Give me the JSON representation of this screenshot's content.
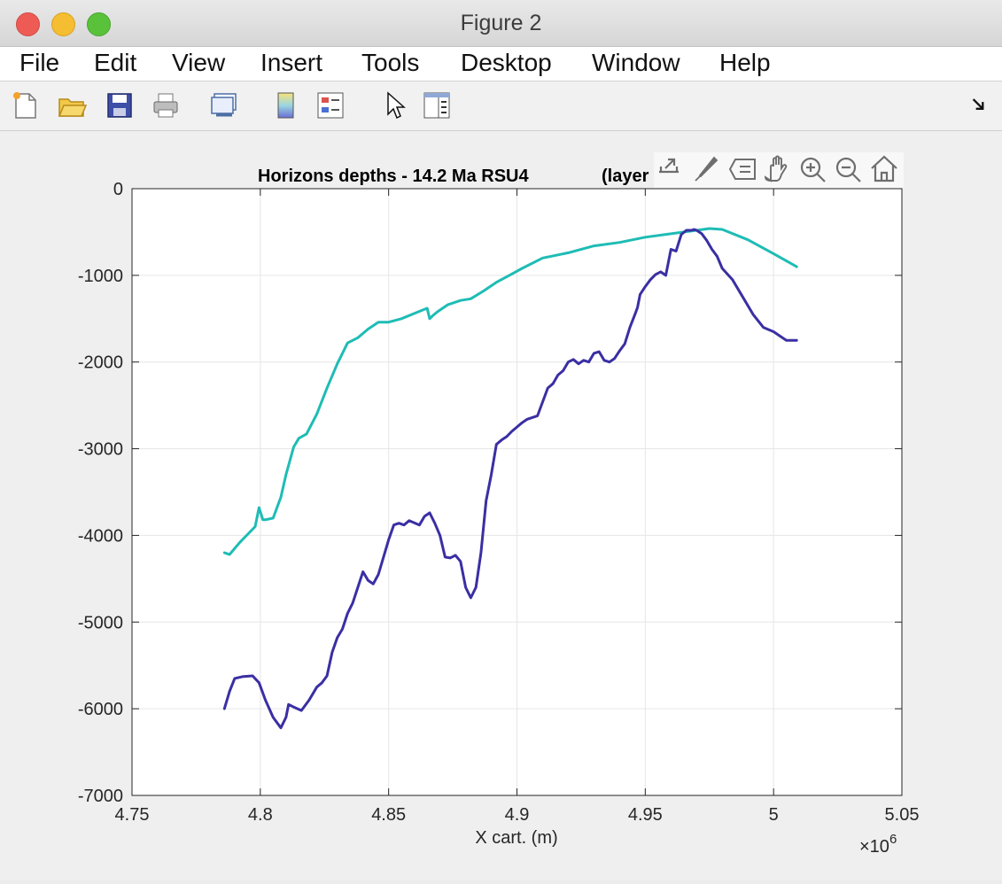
{
  "window": {
    "title": "Figure 2"
  },
  "menu": [
    "File",
    "Edit",
    "View",
    "Insert",
    "Tools",
    "Desktop",
    "Window",
    "Help"
  ],
  "toolbar_icons": [
    "new-figure-icon",
    "open-file-icon",
    "save-icon",
    "print-icon",
    "link-plot-icon",
    "colorbar-icon",
    "legend-icon",
    "edit-pointer-icon",
    "property-inspector-icon",
    "dock-arrow-icon"
  ],
  "axes_toolbar_icons": [
    "export-icon",
    "brush-icon",
    "datatips-icon",
    "pan-icon",
    "zoom-in-icon",
    "zoom-out-icon",
    "home-icon"
  ],
  "colors": {
    "cyan_series": "#1ebcb5",
    "blue_series": "#3a2fa3"
  },
  "chart_data": {
    "type": "line",
    "title_left": "Horizons depths - 14.2 Ma   RSU4",
    "title_right": "(layer",
    "xlabel": "X cart. (m)",
    "x_multiplier": "×10",
    "x_multiplier_exp": "6",
    "ylabel": "",
    "xlim": [
      4750000,
      5050000
    ],
    "ylim": [
      -7000,
      0
    ],
    "xticks": [
      4750000,
      4800000,
      4850000,
      4900000,
      4950000,
      5000000,
      5050000
    ],
    "xtick_labels": [
      "4.75",
      "4.8",
      "4.85",
      "4.9",
      "4.95",
      "5",
      "5.05"
    ],
    "yticks": [
      0,
      -1000,
      -2000,
      -3000,
      -4000,
      -5000,
      -6000,
      -7000
    ],
    "ytick_labels": [
      "0",
      "-1000",
      "-2000",
      "-3000",
      "-4000",
      "-5000",
      "-6000",
      "-7000"
    ],
    "grid": true,
    "series": [
      {
        "color": "#1ebcb5",
        "x": [
          4786000,
          4788000,
          4792000,
          4796000,
          4798000,
          4799500,
          4801000,
          4802000,
          4805000,
          4808000,
          4810000,
          4813000,
          4815000,
          4818000,
          4822000,
          4826000,
          4830000,
          4834000,
          4838000,
          4842000,
          4846000,
          4850000,
          4855000,
          4860000,
          4865000,
          4866000,
          4867000,
          4869000,
          4873000,
          4878000,
          4882000,
          4887000,
          4892000,
          4897000,
          4902000,
          4910000,
          4920000,
          4930000,
          4940000,
          4950000,
          4960000,
          4970000,
          4975000,
          4980000,
          4990000,
          5000000,
          5009000
        ],
        "y": [
          -4200,
          -4220,
          -4080,
          -3960,
          -3900,
          -3680,
          -3820,
          -3820,
          -3800,
          -3560,
          -3300,
          -2980,
          -2880,
          -2830,
          -2600,
          -2300,
          -2020,
          -1780,
          -1720,
          -1620,
          -1540,
          -1540,
          -1500,
          -1440,
          -1380,
          -1500,
          -1470,
          -1420,
          -1340,
          -1290,
          -1270,
          -1180,
          -1080,
          -1000,
          -920,
          -800,
          -740,
          -660,
          -620,
          -560,
          -520,
          -480,
          -460,
          -470,
          -590,
          -750,
          -900
        ]
      },
      {
        "color": "#3a2fa3",
        "x": [
          4786000,
          4788000,
          4790000,
          4793000,
          4797000,
          4799500,
          4802000,
          4805000,
          4808000,
          4810000,
          4811000,
          4813000,
          4816000,
          4819000,
          4822000,
          4824000,
          4826000,
          4828000,
          4830000,
          4832000,
          4834000,
          4836000,
          4838000,
          4840000,
          4842000,
          4844000,
          4846000,
          4848000,
          4850000,
          4852000,
          4854000,
          4856000,
          4858000,
          4862000,
          4864000,
          4866000,
          4867000,
          4868000,
          4870000,
          4872000,
          4874000,
          4876000,
          4878000,
          4880000,
          4882000,
          4884000,
          4886000,
          4888000,
          4890000,
          4892000,
          4894000,
          4896000,
          4898000,
          4900000,
          4902000,
          4904000,
          4908000,
          4912000,
          4914000,
          4916000,
          4918000,
          4920000,
          4922000,
          4924000,
          4926000,
          4928000,
          4930000,
          4932000,
          4934000,
          4936000,
          4938000,
          4940000,
          4942000,
          4944000,
          4946000,
          4947000,
          4948000,
          4950000,
          4952000,
          4954000,
          4956000,
          4958000,
          4960000,
          4962000,
          4964000,
          4966000,
          4968000,
          4969000,
          4970000,
          4972000,
          4974000,
          4976000,
          4978000,
          4980000,
          4984000,
          4988000,
          4992000,
          4996000,
          5000000,
          5005000,
          5009000
        ],
        "y": [
          -6000,
          -5800,
          -5650,
          -5630,
          -5620,
          -5700,
          -5900,
          -6100,
          -6220,
          -6100,
          -5950,
          -5980,
          -6020,
          -5900,
          -5750,
          -5700,
          -5620,
          -5350,
          -5180,
          -5080,
          -4900,
          -4780,
          -4600,
          -4420,
          -4520,
          -4560,
          -4450,
          -4250,
          -4050,
          -3880,
          -3860,
          -3880,
          -3830,
          -3880,
          -3780,
          -3740,
          -3800,
          -3860,
          -4000,
          -4250,
          -4260,
          -4230,
          -4300,
          -4600,
          -4720,
          -4600,
          -4200,
          -3600,
          -3300,
          -2950,
          -2900,
          -2860,
          -2800,
          -2750,
          -2700,
          -2660,
          -2620,
          -2300,
          -2250,
          -2150,
          -2100,
          -2000,
          -1970,
          -2020,
          -1980,
          -2000,
          -1900,
          -1880,
          -1980,
          -2000,
          -1960,
          -1870,
          -1790,
          -1600,
          -1450,
          -1370,
          -1220,
          -1130,
          -1050,
          -990,
          -960,
          -1000,
          -700,
          -720,
          -530,
          -480,
          -480,
          -470,
          -480,
          -520,
          -600,
          -700,
          -780,
          -920,
          -1050,
          -1250,
          -1450,
          -1600,
          -1650,
          -1750,
          -1750
        ]
      }
    ]
  }
}
